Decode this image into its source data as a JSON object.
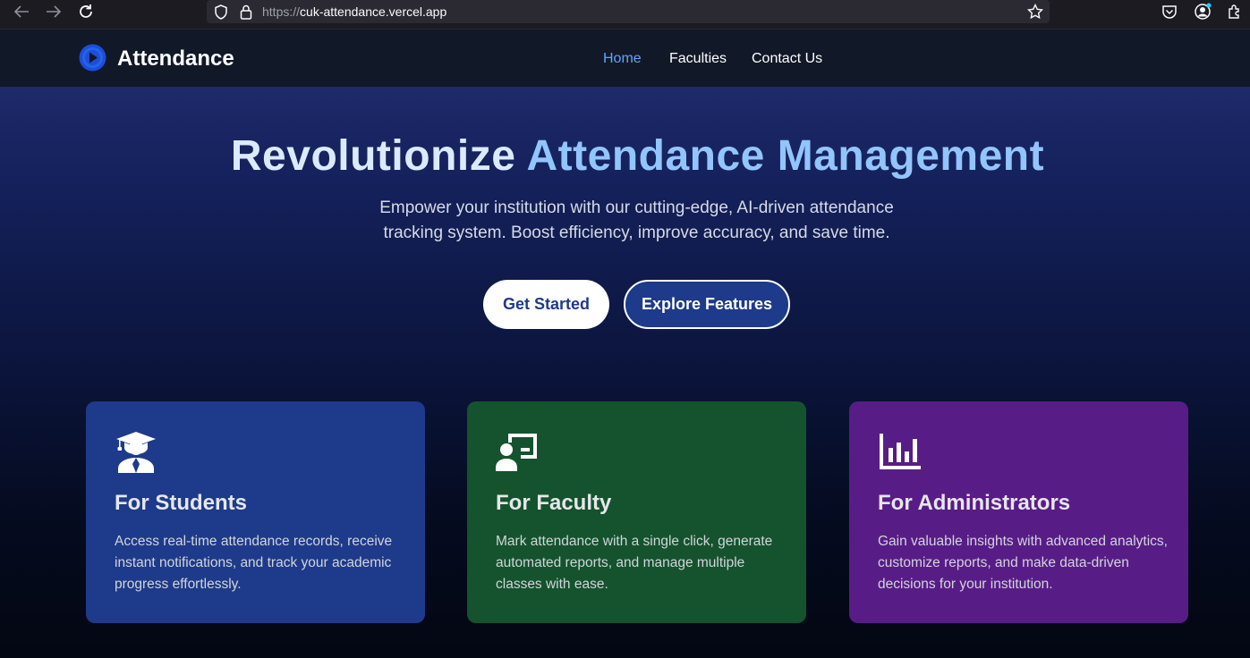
{
  "browser": {
    "url_protocol": "https://",
    "url_host": "cuk-attendance.vercel.app"
  },
  "site": {
    "brand": "Attendance",
    "nav": [
      {
        "label": "Home",
        "active": true
      },
      {
        "label": "Faculties",
        "active": false
      },
      {
        "label": "Contact Us",
        "active": false
      }
    ]
  },
  "hero": {
    "title_part1": "Revolutionize",
    "title_part2": "Attendance Management",
    "subtitle": "Empower your institution with our cutting-edge, AI-driven attendance tracking system. Boost efficiency, improve accuracy, and save time.",
    "primary_button": "Get Started",
    "secondary_button": "Explore Features"
  },
  "cards": [
    {
      "title": "For Students",
      "description": "Access real-time attendance records, receive instant notifications, and track your academic progress effortlessly.",
      "icon": "graduate-icon",
      "color": "#1e3a8a"
    },
    {
      "title": "For Faculty",
      "description": "Mark attendance with a single click, generate automated reports, and manage multiple classes with ease.",
      "icon": "teacher-board-icon",
      "color": "#14532d"
    },
    {
      "title": "For Administrators",
      "description": "Gain valuable insights with advanced analytics, customize reports, and make data-driven decisions for your institution.",
      "icon": "bar-chart-icon",
      "color": "#581c87"
    }
  ],
  "colors": {
    "accent": "#60a5fa",
    "title_light": "#dbeafe",
    "title_highlight": "#93c5fd"
  }
}
